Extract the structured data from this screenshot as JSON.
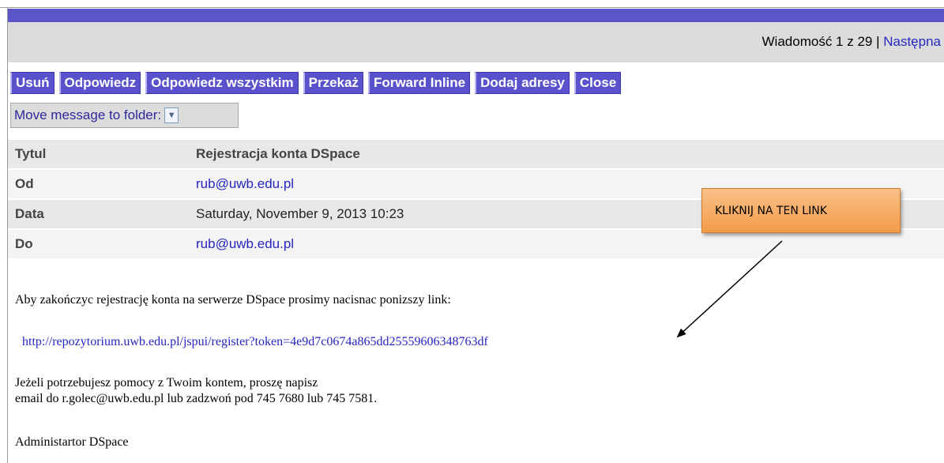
{
  "nav": {
    "counter_text": "Wiadomość 1 z 29 | ",
    "next_label": "Następna"
  },
  "toolbar": {
    "buttons": [
      "Usuń",
      "Odpowiedz",
      "Odpowiedz wszystkim",
      "Przekaż",
      "Forward Inline",
      "Dodaj adresy",
      "Close"
    ],
    "move_label": "Move message to folder:",
    "move_select_icon": "chevron-down-icon"
  },
  "headers": [
    {
      "label": "Tytul",
      "value": "Rejestracja konta DSpace"
    },
    {
      "label": "Od",
      "value": "rub@uwb.edu.pl"
    },
    {
      "label": "Data",
      "value": "Saturday, November 9, 2013 10:23"
    },
    {
      "label": "Do",
      "value": "rub@uwb.edu.pl"
    }
  ],
  "message": {
    "intro": "Aby zakończyc rejestrację konta na serwerze DSpace prosimy nacisnac ponizszy link:",
    "link": "http://repozytorium.uwb.edu.pl/jspui/register?token=4e9d7c0674a865dd25559606348763df",
    "help_line1": "Jeżeli potrzebujesz pomocy z Twoim kontem, proszę napisz",
    "help_line2": "email do r.golec@uwb.edu.pl lub zadzwoń pod 745 7680 lub 745 7581.",
    "signature": "Administartor DSpace"
  },
  "annotation": {
    "callout_text": "KLIKNIJ NA TEN LINK"
  },
  "colors": {
    "accent": "#5a52cc",
    "link": "#2626c0",
    "callout": "#f39c4a"
  }
}
